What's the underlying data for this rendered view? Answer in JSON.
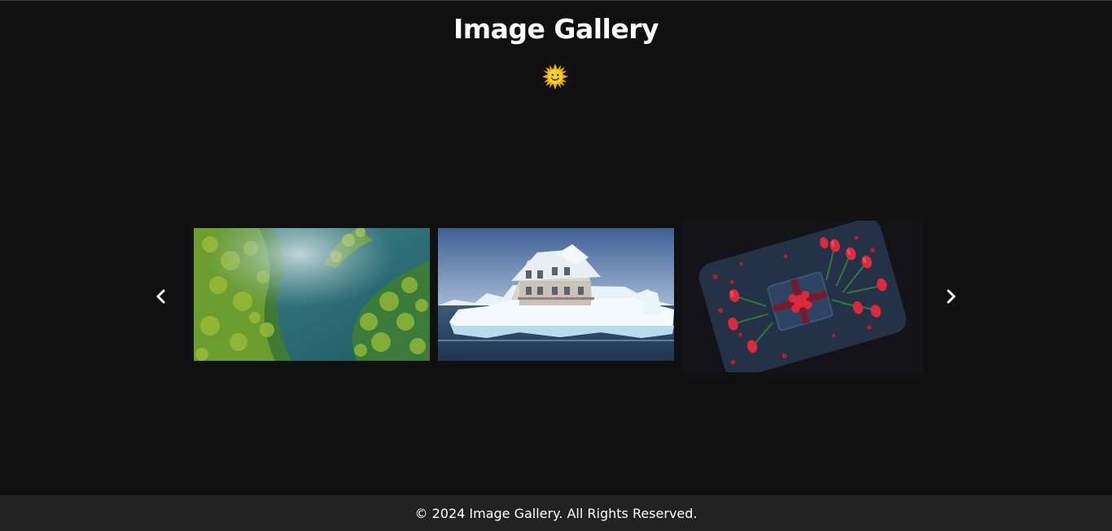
{
  "header": {
    "title": "Image Gallery",
    "theme_toggle_icon": "sun-face-icon"
  },
  "carousel": {
    "prev_icon": "chevron-left-icon",
    "next_icon": "chevron-right-icon",
    "images": [
      {
        "name": "forest-aerial-image"
      },
      {
        "name": "iceberg-house-image"
      },
      {
        "name": "tulips-gift-image"
      }
    ]
  },
  "footer": {
    "text": "© 2024 Image Gallery. All Rights Reserved."
  },
  "colors": {
    "background": "#111111",
    "footer_bg": "#222222",
    "text": "#ffffff"
  }
}
